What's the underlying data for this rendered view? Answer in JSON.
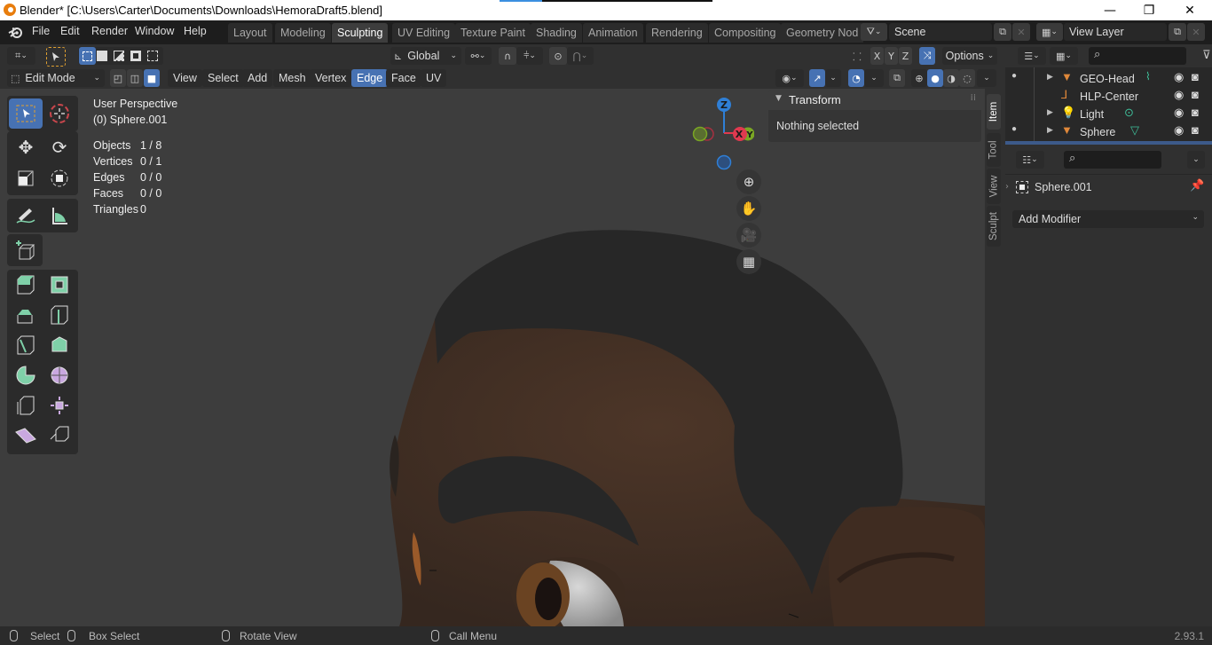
{
  "window": {
    "title": "Blender* [C:\\Users\\Carter\\Documents\\Downloads\\HemoraDraft5.blend]",
    "minimize": "—",
    "restore": "❐",
    "close": "✕"
  },
  "menu": [
    "File",
    "Edit",
    "Render",
    "Window",
    "Help"
  ],
  "workspaces": [
    {
      "label": "Layout",
      "active": false
    },
    {
      "label": "Modeling",
      "active": false
    },
    {
      "label": "Sculpting",
      "active": true
    },
    {
      "label": "UV Editing",
      "active": false
    },
    {
      "label": "Texture Paint",
      "active": false
    },
    {
      "label": "Shading",
      "active": false
    },
    {
      "label": "Animation",
      "active": false
    },
    {
      "label": "Rendering",
      "active": false
    },
    {
      "label": "Compositing",
      "active": false
    },
    {
      "label": "Geometry Nod",
      "active": false
    }
  ],
  "scene": {
    "name": "Scene",
    "view_layer": "View Layer"
  },
  "header1": {
    "transform_orientation": "Global",
    "axes": [
      "X",
      "Y",
      "Z"
    ],
    "options_label": "Options"
  },
  "header2": {
    "mode": "Edit Mode",
    "menus": [
      "View",
      "Select",
      "Add",
      "Mesh",
      "Vertex",
      "Edge",
      "Face",
      "UV"
    ],
    "active_menu": "Edge"
  },
  "viewport": {
    "perspective": "User Perspective",
    "object": "(0) Sphere.001",
    "stats": [
      {
        "label": "Objects",
        "value": "1 / 8"
      },
      {
        "label": "Vertices",
        "value": "0 / 1"
      },
      {
        "label": "Edges",
        "value": "0 / 0"
      },
      {
        "label": "Faces",
        "value": "0 / 0"
      },
      {
        "label": "Triangles",
        "value": "0"
      }
    ],
    "gizmo": {
      "z": "Z",
      "x": "X",
      "y": "Y"
    }
  },
  "npanel": {
    "section": "Transform",
    "message": "Nothing selected",
    "tabs": [
      "Item",
      "Tool",
      "View",
      "Sculpt"
    ],
    "active_tab": "Item"
  },
  "outliner": {
    "items": [
      {
        "name": "GEO-Head",
        "icon": "mesh-object-icon",
        "expandable": true,
        "dot": true
      },
      {
        "name": "HLP-Center",
        "icon": "empty-object-icon",
        "expandable": false,
        "dot": false
      },
      {
        "name": "Light",
        "icon": "light-object-icon",
        "expandable": true,
        "dot": false
      },
      {
        "name": "Sphere",
        "icon": "mesh-object-icon",
        "expandable": true,
        "dot": true
      }
    ]
  },
  "properties": {
    "object_name": "Sphere.001",
    "add_modifier": "Add Modifier"
  },
  "statusbar": {
    "items": [
      "Select",
      "Box Select",
      "Rotate View",
      "Call Menu"
    ],
    "version": "2.93.1"
  },
  "colors": {
    "accent": "#4772b3",
    "object_orange": "#e0883a",
    "data_green": "#3fbf9a",
    "axis_x": "#e0394f",
    "axis_y": "#7aa624",
    "axis_z": "#2f7fd6"
  }
}
